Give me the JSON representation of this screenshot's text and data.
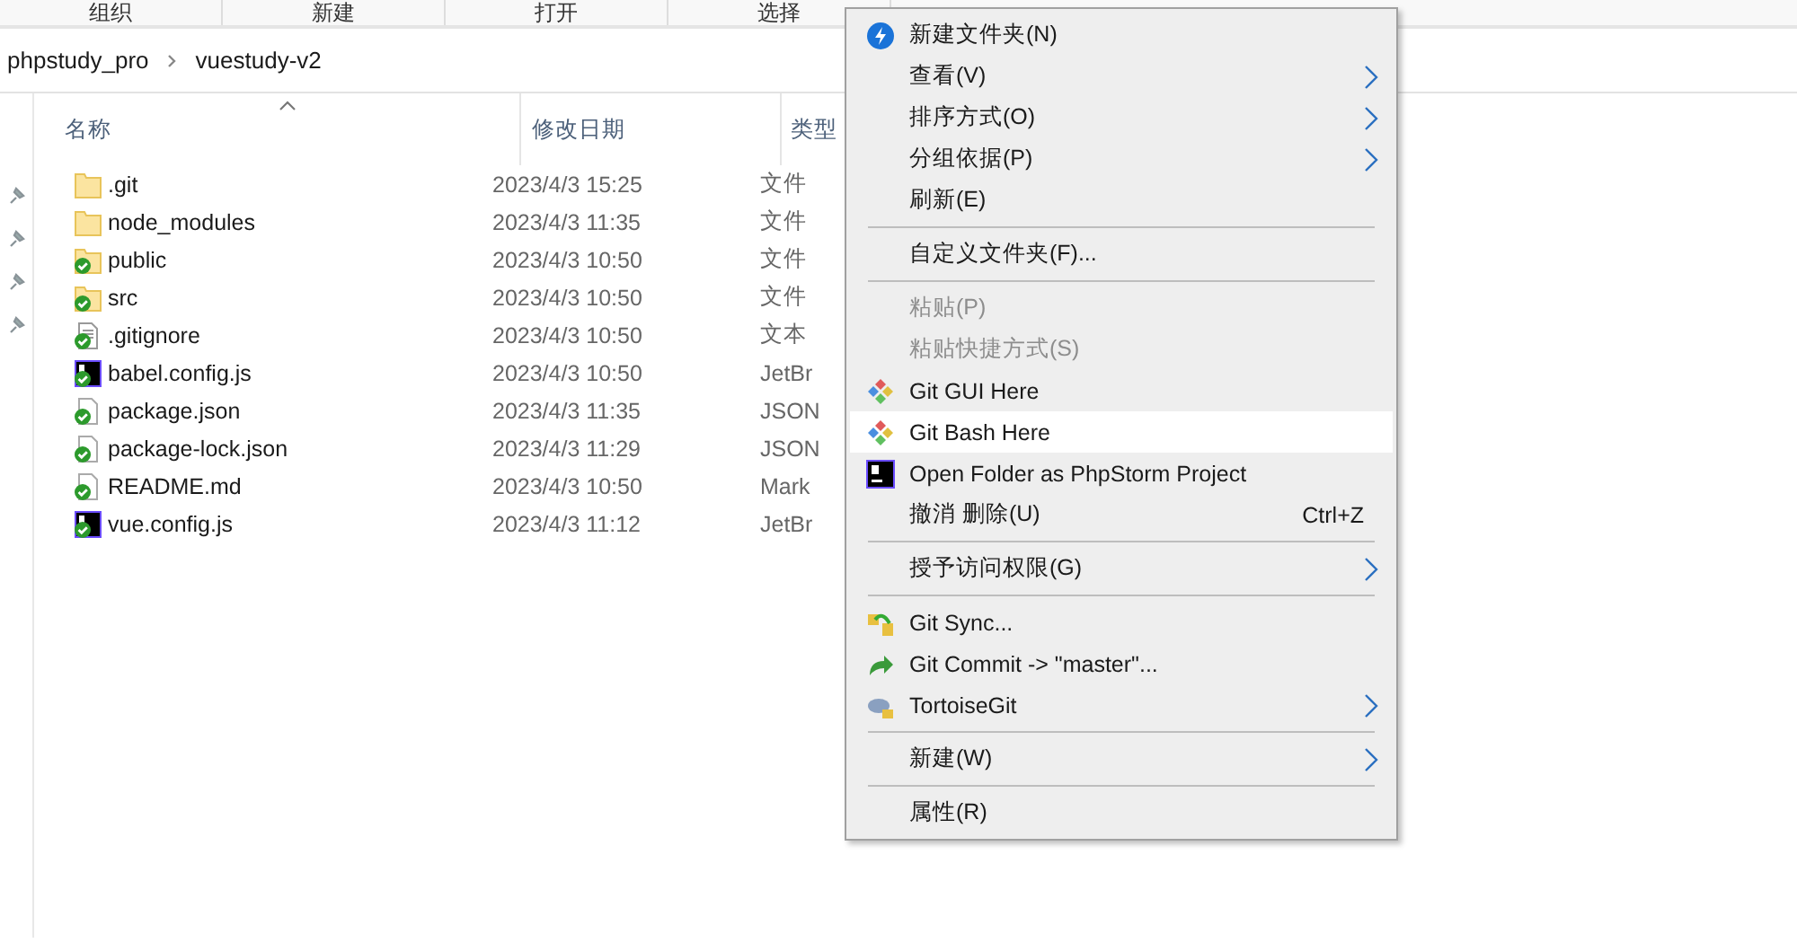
{
  "toolbar": [
    "组织",
    "新建",
    "打开",
    "选择"
  ],
  "breadcrumb": [
    "phpstudy_pro",
    "vuestudy-v2"
  ],
  "columns": [
    "名称",
    "修改日期",
    "类型"
  ],
  "files": [
    {
      "name": ".git",
      "date": "2023/4/3 15:25",
      "type": "文件",
      "kind": "folder",
      "versioned": false
    },
    {
      "name": "node_modules",
      "date": "2023/4/3 11:35",
      "type": "文件",
      "kind": "folder",
      "versioned": false
    },
    {
      "name": "public",
      "date": "2023/4/3 10:50",
      "type": "文件",
      "kind": "folder",
      "versioned": true
    },
    {
      "name": "src",
      "date": "2023/4/3 10:50",
      "type": "文件",
      "kind": "folder",
      "versioned": true
    },
    {
      "name": ".gitignore",
      "date": "2023/4/3 10:50",
      "type": "文本",
      "kind": "text",
      "versioned": true
    },
    {
      "name": "babel.config.js",
      "date": "2023/4/3 10:50",
      "type": "JetBr",
      "kind": "script",
      "versioned": true
    },
    {
      "name": "package.json",
      "date": "2023/4/3 11:35",
      "type": "JSON",
      "kind": "file",
      "versioned": true
    },
    {
      "name": "package-lock.json",
      "date": "2023/4/3 11:29",
      "type": "JSON",
      "kind": "file",
      "versioned": true
    },
    {
      "name": "README.md",
      "date": "2023/4/3 10:50",
      "type": "Mark",
      "kind": "file",
      "versioned": true
    },
    {
      "name": "vue.config.js",
      "date": "2023/4/3 11:12",
      "type": "JetBr",
      "kind": "script",
      "versioned": true
    }
  ],
  "menu": [
    {
      "kind": "item",
      "label": "新建文件夹(N)",
      "submenu": false,
      "disabled": false,
      "selected": false
    },
    {
      "kind": "item",
      "label": "查看(V)",
      "submenu": true,
      "disabled": false,
      "selected": false
    },
    {
      "kind": "item",
      "label": "排序方式(O)",
      "submenu": true,
      "disabled": false,
      "selected": false
    },
    {
      "kind": "item",
      "label": "分组依据(P)",
      "submenu": true,
      "disabled": false,
      "selected": false
    },
    {
      "kind": "item",
      "label": "刷新(E)",
      "submenu": false,
      "disabled": false,
      "selected": false
    },
    {
      "kind": "separator"
    },
    {
      "kind": "item",
      "label": "自定义文件夹(F)...",
      "submenu": false,
      "disabled": false,
      "selected": false
    },
    {
      "kind": "separator"
    },
    {
      "kind": "item",
      "label": "粘贴(P)",
      "submenu": false,
      "disabled": true,
      "selected": false
    },
    {
      "kind": "item",
      "label": "粘贴快捷方式(S)",
      "submenu": false,
      "disabled": true,
      "selected": false
    },
    {
      "kind": "item",
      "label": "Git GUI Here",
      "submenu": false,
      "disabled": false,
      "selected": false
    },
    {
      "kind": "item",
      "label": "Git Bash Here",
      "submenu": false,
      "disabled": false,
      "selected": true
    },
    {
      "kind": "item",
      "label": "Open Folder as PhpStorm Project",
      "submenu": false,
      "disabled": false,
      "selected": false
    },
    {
      "kind": "item",
      "label": "撤消 删除(U)",
      "shortcut": "Ctrl+Z",
      "submenu": false,
      "disabled": false,
      "selected": false
    },
    {
      "kind": "separator"
    },
    {
      "kind": "item",
      "label": "授予访问权限(G)",
      "submenu": true,
      "disabled": false,
      "selected": false
    },
    {
      "kind": "separator"
    },
    {
      "kind": "item",
      "label": "Git Sync...",
      "submenu": false,
      "disabled": false,
      "selected": false
    },
    {
      "kind": "item",
      "label": "Git Commit -> \"master\"...",
      "submenu": false,
      "disabled": false,
      "selected": false
    },
    {
      "kind": "item",
      "label": "TortoiseGit",
      "submenu": true,
      "disabled": false,
      "selected": false
    },
    {
      "kind": "separator"
    },
    {
      "kind": "item",
      "label": "新建(W)",
      "submenu": true,
      "disabled": false,
      "selected": false
    },
    {
      "kind": "separator"
    },
    {
      "kind": "item",
      "label": "属性(R)",
      "submenu": false,
      "disabled": false,
      "selected": false
    }
  ]
}
